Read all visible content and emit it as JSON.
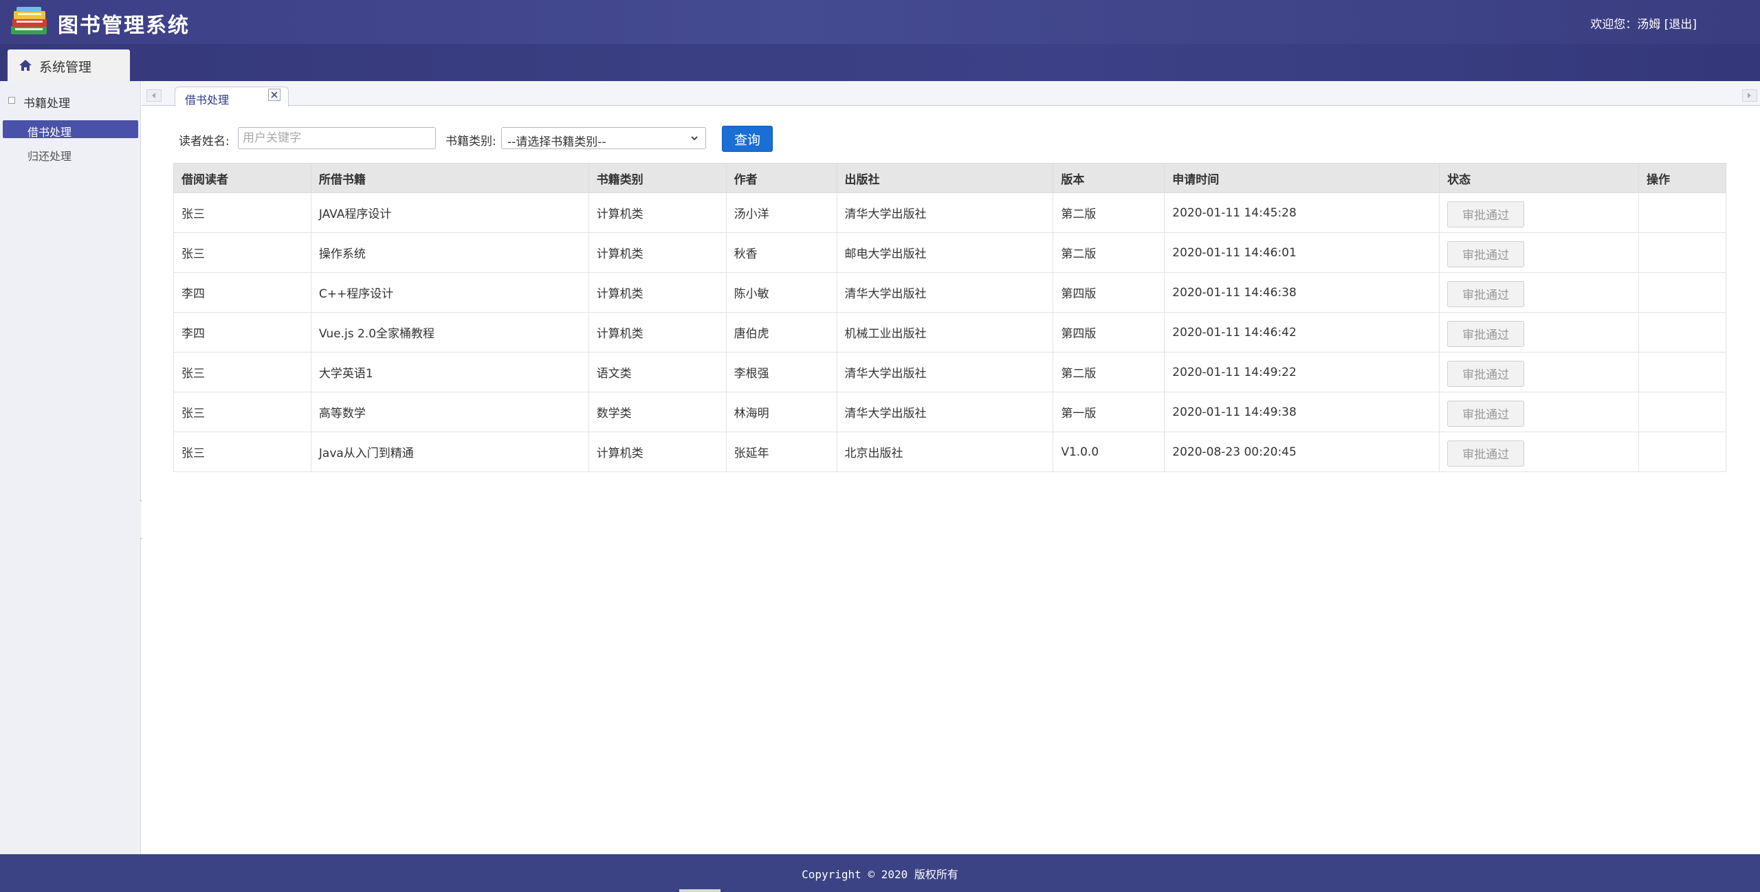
{
  "header": {
    "app_title": "图书管理系统",
    "welcome_prefix": "欢迎您：汤姆 [",
    "logout_label": "退出",
    "welcome_suffix": "]"
  },
  "navbar": {
    "tab_label": "系统管理"
  },
  "sidebar": {
    "group_label": "书籍处理",
    "items": [
      {
        "label": "借书处理",
        "active": true
      },
      {
        "label": "归还处理",
        "active": false
      }
    ]
  },
  "tabs": {
    "current": "借书处理"
  },
  "search": {
    "reader_label": "读者姓名:",
    "reader_placeholder": "用户关键字",
    "category_label": "书籍类别:",
    "category_selected": "--请选择书籍类别--",
    "query_label": "查询"
  },
  "table": {
    "headers": [
      "借阅读者",
      "所借书籍",
      "书籍类别",
      "作者",
      "出版社",
      "版本",
      "申请时间",
      "状态",
      "操作"
    ],
    "rows": [
      {
        "reader": "张三",
        "book": "JAVA程序设计",
        "category": "计算机类",
        "author": "汤小洋",
        "publisher": "清华大学出版社",
        "edition": "第二版",
        "time": "2020-01-11 14:45:28",
        "status": "审批通过",
        "action": ""
      },
      {
        "reader": "张三",
        "book": "操作系统",
        "category": "计算机类",
        "author": "秋香",
        "publisher": "邮电大学出版社",
        "edition": "第二版",
        "time": "2020-01-11 14:46:01",
        "status": "审批通过",
        "action": ""
      },
      {
        "reader": "李四",
        "book": "C++程序设计",
        "category": "计算机类",
        "author": "陈小敏",
        "publisher": "清华大学出版社",
        "edition": "第四版",
        "time": "2020-01-11 14:46:38",
        "status": "审批通过",
        "action": ""
      },
      {
        "reader": "李四",
        "book": "Vue.js 2.0全家桶教程",
        "category": "计算机类",
        "author": "唐伯虎",
        "publisher": "机械工业出版社",
        "edition": "第四版",
        "time": "2020-01-11 14:46:42",
        "status": "审批通过",
        "action": ""
      },
      {
        "reader": "张三",
        "book": "大学英语1",
        "category": "语文类",
        "author": "李根强",
        "publisher": "清华大学出版社",
        "edition": "第二版",
        "time": "2020-01-11 14:49:22",
        "status": "审批通过",
        "action": ""
      },
      {
        "reader": "张三",
        "book": "高等数学",
        "category": "数学类",
        "author": "林海明",
        "publisher": "清华大学出版社",
        "edition": "第一版",
        "time": "2020-01-11 14:49:38",
        "status": "审批通过",
        "action": ""
      },
      {
        "reader": "张三",
        "book": "Java从入门到精通",
        "category": "计算机类",
        "author": "张延年",
        "publisher": "北京出版社",
        "edition": "V1.0.0",
        "time": "2020-08-23 00:20:45",
        "status": "审批通过",
        "action": ""
      }
    ]
  },
  "footer": {
    "copyright": "Copyright © 2020 版权所有"
  },
  "colors": {
    "header_bg": "#3c3f86",
    "accent_blue": "#1a6fd6",
    "sidebar_active": "#4a51a8",
    "footer_bg": "#3b4384"
  },
  "icons": {
    "logo": "books-logo-icon",
    "home": "home-icon",
    "close": "close-icon",
    "dropdown": "chevron-down-icon"
  }
}
